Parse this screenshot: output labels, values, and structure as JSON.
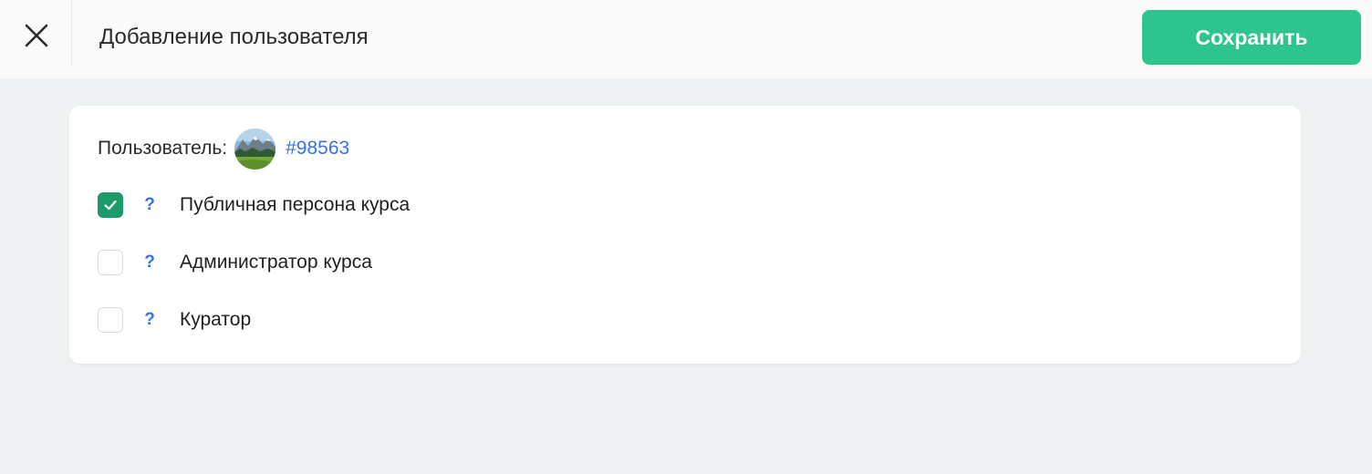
{
  "header": {
    "title": "Добавление пользователя",
    "close_icon": "close-icon",
    "save_label": "Сохранить"
  },
  "user": {
    "label": "Пользователь:",
    "id": "#98563",
    "avatar": "landscape-avatar"
  },
  "options": [
    {
      "label": "Публичная персона курса",
      "checked": true,
      "help": "?"
    },
    {
      "label": "Администратор курса",
      "checked": false,
      "help": "?"
    },
    {
      "label": "Куратор",
      "checked": false,
      "help": "?"
    }
  ],
  "colors": {
    "accent": "#2ec48d",
    "checkbox_checked": "#1c9a69",
    "link": "#3571e8",
    "background": "#eff2f3"
  }
}
